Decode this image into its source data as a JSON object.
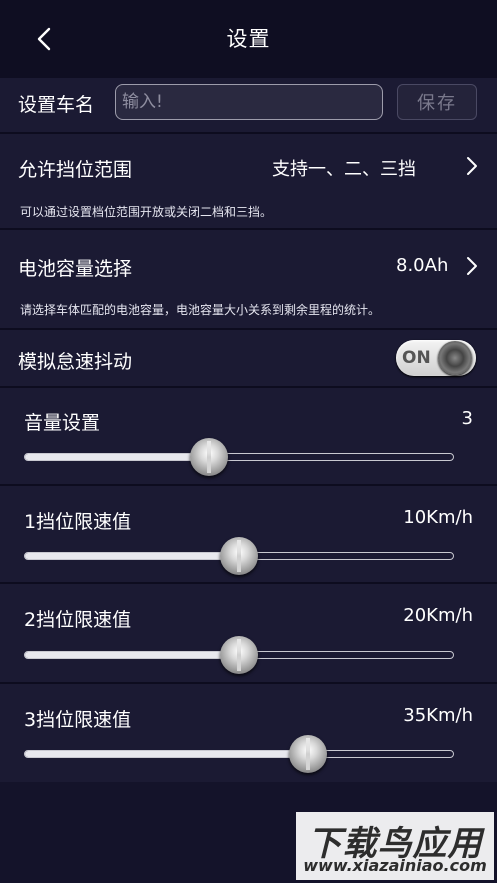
{
  "header": {
    "title": "设置"
  },
  "car_name": {
    "label": "设置车名",
    "placeholder": "输入!",
    "value": "",
    "save_label": "保存"
  },
  "gear_range": {
    "label": "允许挡位范围",
    "value": "支持一、二、三挡",
    "description": "可以通过设置档位范围开放或关闭二档和三挡。"
  },
  "battery": {
    "label": "电池容量选择",
    "value": "8.0Ah",
    "description": "请选择车体匹配的电池容量，电池容量大小关系到剩余里程的统计。"
  },
  "shake": {
    "label": "模拟怠速抖动",
    "toggle_text": "ON",
    "enabled": true
  },
  "sliders": [
    {
      "label": "音量设置",
      "value": "3",
      "fraction": 0.43
    },
    {
      "label": "1挡位限速值",
      "value": "10Km/h",
      "fraction": 0.5
    },
    {
      "label": "2挡位限速值",
      "value": "20Km/h",
      "fraction": 0.5
    },
    {
      "label": "3挡位限速值",
      "value": "35Km/h",
      "fraction": 0.66
    }
  ],
  "watermark": {
    "title": "下载鸟应用",
    "url": "www.xiazainiao.com"
  },
  "colors": {
    "background": "#14132a",
    "row": "#1b1a33",
    "header": "#0f0e22"
  },
  "icons": {
    "back": "chevron-left-icon",
    "forward": "chevron-right-icon"
  }
}
